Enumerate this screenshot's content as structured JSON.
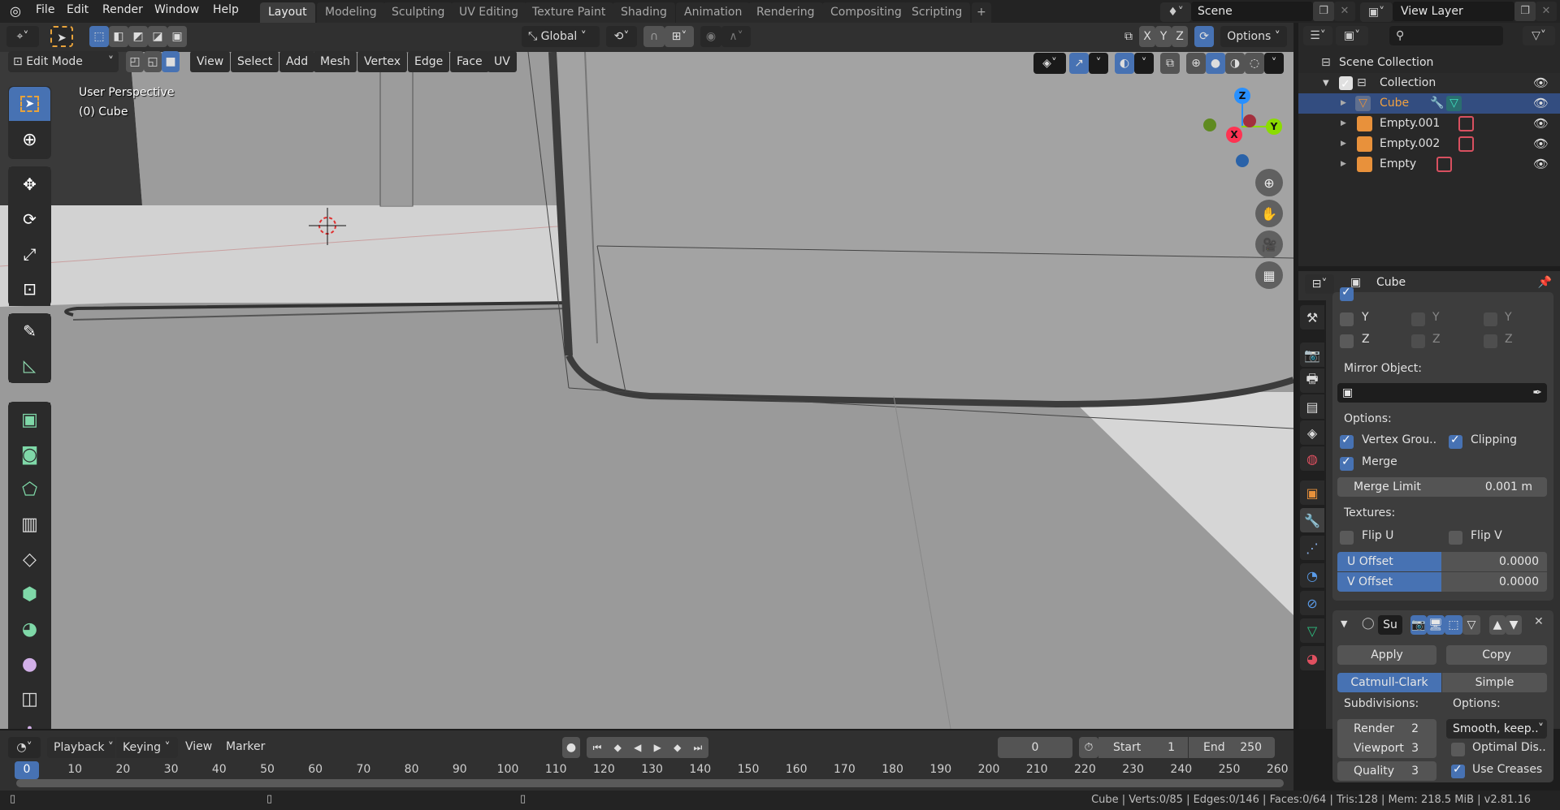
{
  "app": {
    "title": "Blender",
    "version": "v2.81.16"
  },
  "menu": [
    "File",
    "Edit",
    "Render",
    "Window",
    "Help"
  ],
  "workspaces": [
    {
      "label": "Layout",
      "active": true
    },
    {
      "label": "Modeling"
    },
    {
      "label": "Sculpting"
    },
    {
      "label": "UV Editing"
    },
    {
      "label": "Texture Paint"
    },
    {
      "label": "Shading"
    },
    {
      "label": "Animation"
    },
    {
      "label": "Rendering"
    },
    {
      "label": "Compositing"
    },
    {
      "label": "Scripting"
    }
  ],
  "add_workspace": "+",
  "scene": {
    "name": "Scene",
    "view_layer": "View Layer"
  },
  "viewport": {
    "mode": "Edit Mode",
    "menus": [
      "View",
      "Select",
      "Add",
      "Mesh",
      "Vertex",
      "Edge",
      "Face",
      "UV"
    ],
    "transform_orientation": "Global",
    "options_label": "Options",
    "axes": [
      "X",
      "Y",
      "Z"
    ],
    "perspective_label": "User Perspective",
    "object_label": "(0) Cube",
    "gizmo": {
      "x": "X",
      "y": "Y",
      "z": "Z",
      "x_color": "#ff3352",
      "y_color": "#8bdc00",
      "z_color": "#2890ff"
    },
    "select_mode": "face",
    "shading": "solid"
  },
  "tools": [
    "select-box",
    "cursor",
    "move",
    "rotate",
    "scale",
    "transform",
    "annotate",
    "measure",
    "extrude-region",
    "inset-faces",
    "bevel",
    "loop-cut",
    "knife",
    "poly-build",
    "spin",
    "smooth",
    "edge-slide",
    "shrink-fatten"
  ],
  "outliner": {
    "root": "Scene Collection",
    "collection": "Collection",
    "items": [
      {
        "name": "Cube",
        "selected": true
      },
      {
        "name": "Empty.001"
      },
      {
        "name": "Empty.002"
      },
      {
        "name": "Empty"
      }
    ]
  },
  "properties": {
    "object_name": "Cube",
    "mirror": {
      "axis_rows": [
        [
          "Y",
          "Y",
          "Y"
        ],
        [
          "Z",
          "Z",
          "Z"
        ]
      ],
      "mirror_object_label": "Mirror Object:",
      "options_label": "Options:",
      "vertex_groups": {
        "label": "Vertex Grou..",
        "checked": true
      },
      "clipping": {
        "label": "Clipping",
        "checked": true
      },
      "merge": {
        "label": "Merge",
        "checked": true
      },
      "merge_limit": {
        "label": "Merge Limit",
        "value": "0.001 m"
      },
      "textures_label": "Textures:",
      "flip_u": {
        "label": "Flip U",
        "checked": false
      },
      "flip_v": {
        "label": "Flip V",
        "checked": false
      },
      "u_offset": {
        "label": "U Offset",
        "value": "0.0000"
      },
      "v_offset": {
        "label": "V Offset",
        "value": "0.0000"
      }
    },
    "subsurf": {
      "name": "Su",
      "apply_label": "Apply",
      "copy_label": "Copy",
      "types": [
        "Catmull-Clark",
        "Simple"
      ],
      "active_type": "Catmull-Clark",
      "subdivisions_label": "Subdivisions:",
      "options_label": "Options:",
      "render": {
        "label": "Render",
        "value": "2"
      },
      "viewport": {
        "label": "Viewport",
        "value": "3"
      },
      "quality": {
        "label": "Quality",
        "value": "3"
      },
      "uv_smooth": "Smooth, keep..",
      "optimal_display": {
        "label": "Optimal Dis..",
        "checked": false
      },
      "use_creases": {
        "label": "Use Creases",
        "checked": true
      }
    }
  },
  "timeline": {
    "menus": [
      "Playback",
      "Keying",
      "View",
      "Marker"
    ],
    "current_frame": "0",
    "start_label": "Start",
    "start": "1",
    "end_label": "End",
    "end": "250",
    "ticks": [
      "0",
      "10",
      "20",
      "30",
      "40",
      "50",
      "60",
      "70",
      "80",
      "90",
      "100",
      "110",
      "120",
      "130",
      "140",
      "150",
      "160",
      "170",
      "180",
      "190",
      "200",
      "210",
      "220",
      "230",
      "240",
      "250",
      "260"
    ]
  },
  "status": "Cube | Verts:0/85 | Edges:0/146 | Faces:0/64 | Tris:128 | Mem: 218.5 MiB | v2.81.16",
  "colors": {
    "accent": "#4772b3",
    "selection_row": "#334d80",
    "object_orange": "#e8913b"
  }
}
